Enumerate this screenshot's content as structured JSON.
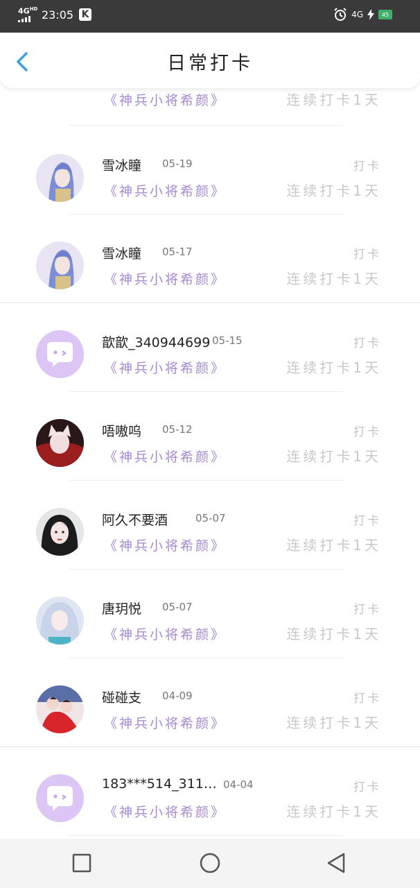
{
  "status_bar": {
    "network_left": "4G",
    "network_left_sup": "HD",
    "time": "23:05",
    "app_badge": "K",
    "network_right": "4G",
    "battery_level": "45",
    "icons": [
      "signal-icon",
      "alarm-icon",
      "charging-icon",
      "battery-icon"
    ]
  },
  "header": {
    "title": "日常打卡",
    "back_icon": "chevron-left-icon"
  },
  "partial_row": {
    "book": "《神兵小将希颜》",
    "streak": "连续打卡1天"
  },
  "entries": [
    {
      "name": "雪冰瞳",
      "date": "05-19",
      "book": "《神兵小将希颜》",
      "action": "打卡",
      "streak": "连续打卡1天",
      "avatar": "anime-avatar-blue-hair"
    },
    {
      "name": "雪冰瞳",
      "date": "05-17",
      "book": "《神兵小将希颜》",
      "action": "打卡",
      "streak": "连续打卡1天",
      "avatar": "anime-avatar-blue-hair"
    },
    {
      "name": "歆歆_340944699",
      "date": "05-15",
      "book": "《神兵小将希颜》",
      "action": "打卡",
      "streak": "连续打卡1天",
      "avatar": "default-chat-avatar"
    },
    {
      "name": "唔嗷呜",
      "date": "05-12",
      "book": "《神兵小将希颜》",
      "action": "打卡",
      "streak": "连续打卡1天",
      "avatar": "anime-avatar-white-fox"
    },
    {
      "name": "阿久不要酒",
      "date": "05-07",
      "book": "《神兵小将希颜》",
      "action": "打卡",
      "streak": "连续打卡1天",
      "avatar": "anime-avatar-dark-hair"
    },
    {
      "name": "唐玥悦",
      "date": "05-07",
      "book": "《神兵小将希颜》",
      "action": "打卡",
      "streak": "连续打卡1天",
      "avatar": "anime-avatar-silver-hair"
    },
    {
      "name": "碰碰支",
      "date": "04-09",
      "book": "《神兵小将希颜》",
      "action": "打卡",
      "streak": "连续打卡1天",
      "avatar": "photo-avatar-couple"
    },
    {
      "name": "183***514_311…",
      "date": "04-04",
      "book": "《神兵小将希颜》",
      "action": "打卡",
      "streak": "连续打卡1天",
      "avatar": "default-chat-avatar"
    }
  ],
  "nav_bar": {
    "buttons": [
      "recent-apps-icon",
      "home-icon",
      "back-triangle-icon"
    ]
  },
  "colors": {
    "book_title": "#a68ad2",
    "default_avatar_bg": "#dcc6f5",
    "back_arrow": "#3aa0e8",
    "status_bar_bg": "#3a3a3a"
  }
}
